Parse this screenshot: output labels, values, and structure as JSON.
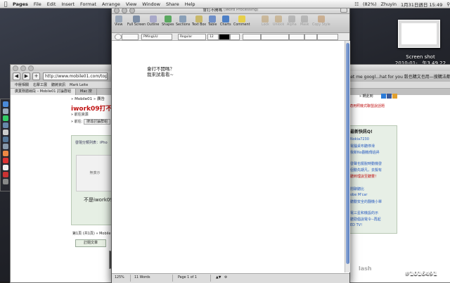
{
  "menubar": {
    "items": [
      "Pages",
      "File",
      "Edit",
      "Insert",
      "Format",
      "Arrange",
      "View",
      "Window",
      "Share",
      "Help"
    ],
    "battery": "(82%)",
    "user": "Zhuyin",
    "datetime": "1月31日週日  15:49"
  },
  "screenshot_thumb": {
    "line1": "Screen shot",
    "line2": "2010-01-...午3.49.22"
  },
  "browser": {
    "url": "http://www.mobile01.com/topicde",
    "search_right": "Let me googl...hat for you   穀也購文也用—搜購法都",
    "bookmarks": [
      "中壓相關",
      "右擊工展",
      "聽將資訊",
      "Mark Leite"
    ],
    "tabs": [
      "廣業務體線段 – Mobile01 討論群組",
      "Mac 搜"
    ],
    "breadcrumb": "» Mobile01 » 廣告",
    "headline": "iwork09打不開v",
    "sub1": "» 前往資源",
    "sub2_label": "» 前往:",
    "sub2_select": "搜尋討論群組",
    "panel_head": "發現分類列表：iPho",
    "ad_text": "無廣示",
    "caption": "不是iwork09",
    "pages_text": "第1頁 (共1頁) » Mobile",
    "subscribe": "訂閱文章",
    "right_label": "» 轉此到",
    "right_link": "適用照機式聯盟說話題",
    "right_box": {
      "head": "最新快訊Q!",
      "lines": [
        "Nokia7230",
        "電腦桌布聽停滑",
        "我新No翻機傳過昇",
        "發聲也擺脫時動機發",
        "個動先期凡，去擬有",
        "聽到理說至聽豐！",
        "閒聊聽比",
        "obe M'car",
        "聽動安全的翻機小單",
        "電三星和機設的示",
        "聽勁倡說電令--再起",
        "ED TV!"
      ]
    },
    "flash": "lash"
  },
  "pages_window": {
    "title": "會打不開嗎",
    "title_sub": "(Word Processing)",
    "toolbar": [
      "View",
      "Full Screen",
      "Outline",
      "Shapes",
      "Sections",
      "Text Box",
      "Table",
      "Charts",
      "Comment",
      "Lock",
      "Unlock",
      "Alpha",
      "Mask",
      "Copy Style"
    ],
    "format": {
      "style": "PMingLiU",
      "weight": "Regular",
      "size": "12"
    },
    "doc_lines": [
      "會打不開嗎？",
      "我來試看看~"
    ],
    "status": {
      "zoom": "125%",
      "words": "11 Words",
      "page": "Page 1 of 1"
    }
  },
  "watermark": "#1016491",
  "colors": {
    "headline_red": "#c01010",
    "panel_green": "#e6efe4",
    "scroll_blue": "#5a7fc0"
  }
}
